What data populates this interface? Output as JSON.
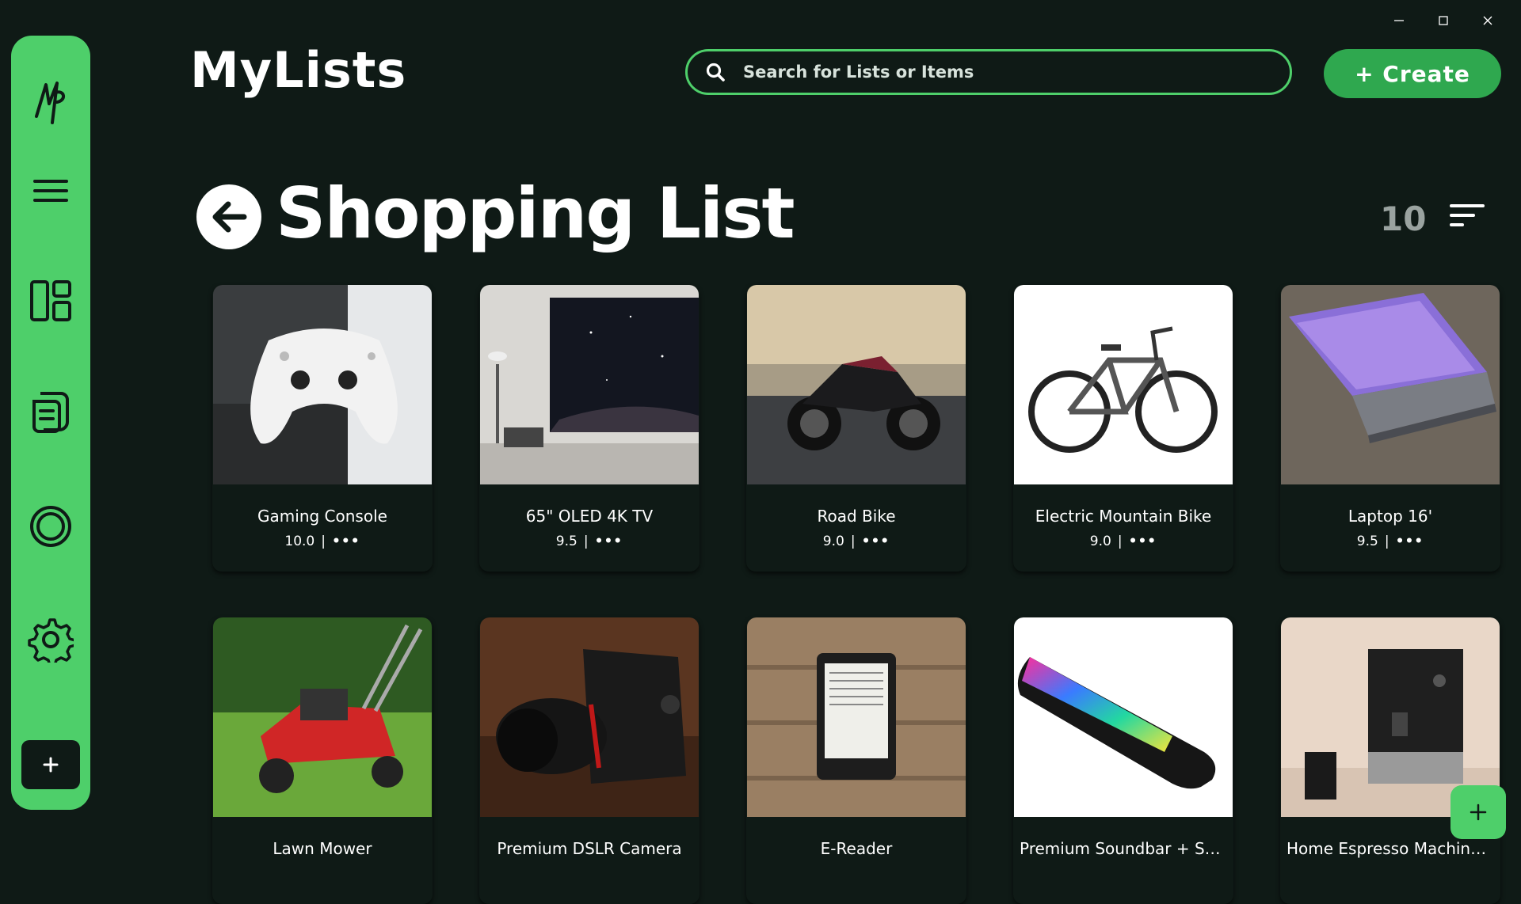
{
  "app": {
    "title": "MyLists"
  },
  "search": {
    "placeholder": "Search for Lists or Items"
  },
  "create_button": {
    "label": "+ Create"
  },
  "list": {
    "title": "Shopping List",
    "count": "10"
  },
  "colors": {
    "accent": "#4ecf6a",
    "background": "#0f1a16",
    "create": "#2fa84f"
  },
  "sidebar": {
    "items": [
      {
        "icon": "logo-icon"
      },
      {
        "icon": "menu-icon"
      },
      {
        "icon": "dashboard-icon"
      },
      {
        "icon": "notes-icon"
      },
      {
        "icon": "circle-icon"
      },
      {
        "icon": "gear-icon"
      },
      {
        "icon": "plus-icon"
      }
    ]
  },
  "items": [
    {
      "name": "Gaming Console",
      "rating": "10.0",
      "image": "game-controller"
    },
    {
      "name": "65\" OLED 4K TV",
      "rating": "9.5",
      "image": "television"
    },
    {
      "name": "Road Bike",
      "rating": "9.0",
      "image": "motorcycle"
    },
    {
      "name": "Electric Mountain Bike",
      "rating": "9.0",
      "image": "bicycle"
    },
    {
      "name": "Laptop 16'",
      "rating": "9.5",
      "image": "laptop"
    },
    {
      "name": "Lawn Mower",
      "rating": "",
      "image": "lawn-mower"
    },
    {
      "name": "Premium DSLR Camera",
      "rating": "",
      "image": "camera"
    },
    {
      "name": "E-Reader",
      "rating": "",
      "image": "e-reader"
    },
    {
      "name": "Premium Soundbar + Sub...",
      "rating": "",
      "image": "soundbar"
    },
    {
      "name": "Home Espresso Machine (...",
      "rating": "",
      "image": "espresso-machine"
    }
  ],
  "more_label": "•••"
}
